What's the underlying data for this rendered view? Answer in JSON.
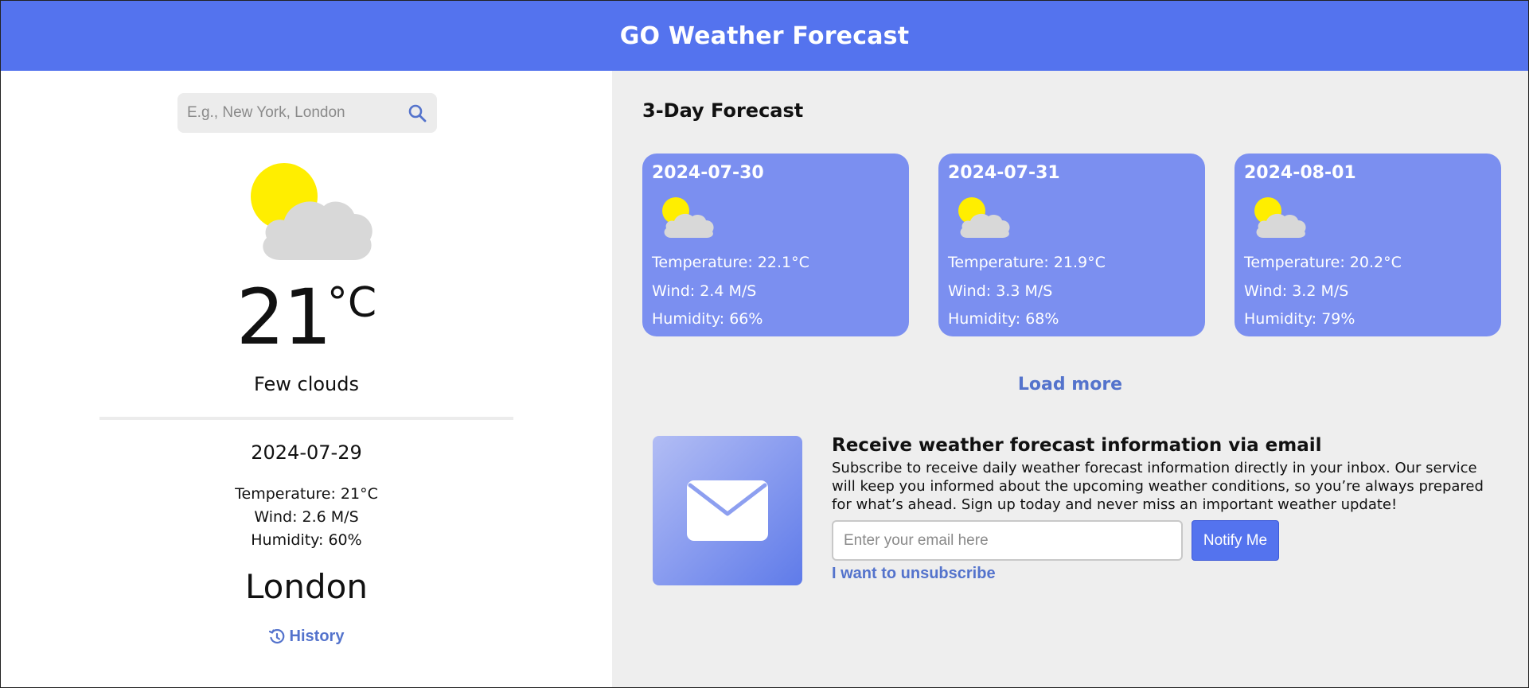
{
  "header": {
    "title": "GO Weather Forecast"
  },
  "search": {
    "placeholder": "E.g., New York, London",
    "value": ""
  },
  "current": {
    "icon": "sun-cloud-icon",
    "temperature": "21",
    "unit": "°C",
    "description": "Few clouds",
    "date": "2024-07-29",
    "temperature_line": "Temperature: 21°C",
    "wind_line": "Wind: 2.6 M/S",
    "humidity_line": "Humidity: 60%",
    "city": "London",
    "history_label": "History"
  },
  "forecast": {
    "title": "3-Day Forecast",
    "days": [
      {
        "date": "2024-07-30",
        "temperature": "Temperature: 22.1°C",
        "wind": "Wind: 2.4 M/S",
        "humidity": "Humidity: 66%"
      },
      {
        "date": "2024-07-31",
        "temperature": "Temperature: 21.9°C",
        "wind": "Wind: 3.3 M/S",
        "humidity": "Humidity: 68%"
      },
      {
        "date": "2024-08-01",
        "temperature": "Temperature: 20.2°C",
        "wind": "Wind: 3.2 M/S",
        "humidity": "Humidity: 79%"
      }
    ],
    "load_more_label": "Load more"
  },
  "subscribe": {
    "title": "Receive weather forecast information via email",
    "text": "Subscribe to receive daily weather forecast information directly in your inbox. Our service will keep you informed about the upcoming weather conditions, so you’re always prepared for what’s ahead. Sign up today and never miss an important weather update!",
    "email_placeholder": "Enter your email here",
    "email_value": "",
    "button_label": "Notify Me",
    "unsubscribe_label": "I want to unsubscribe"
  },
  "colors": {
    "brand": "#5473ee",
    "card": "#7b8ff0",
    "link": "#5473cc",
    "sun": "#ffee00",
    "cloud": "#d8d8d8"
  }
}
